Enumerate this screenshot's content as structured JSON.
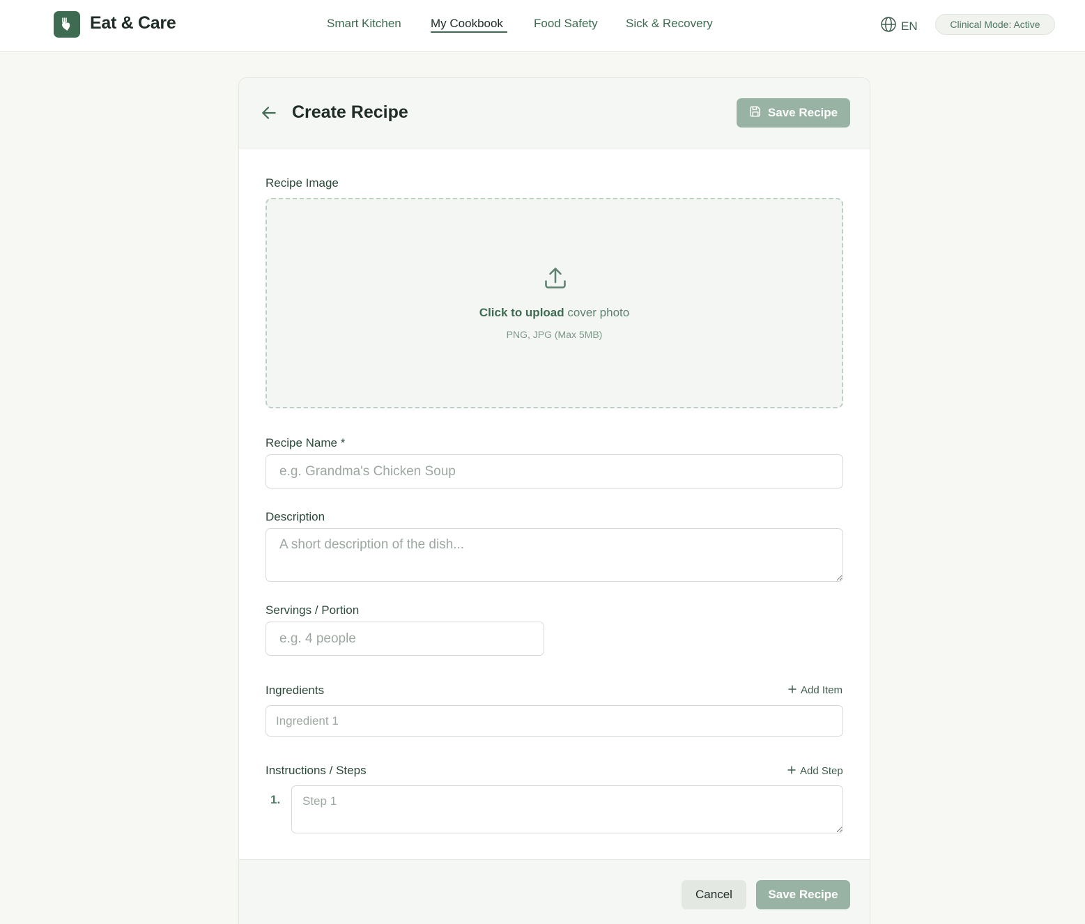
{
  "app": {
    "brand": "Eat & Care",
    "logo_icon": "heart-hand-utensils-icon",
    "accent_color": "#3f6b52"
  },
  "nav": {
    "items": [
      {
        "label": "Smart Kitchen",
        "active": false
      },
      {
        "label": "My Cookbook",
        "active": true
      },
      {
        "label": "Food Safety",
        "active": false
      },
      {
        "label": "Sick & Recovery",
        "active": false
      }
    ],
    "language": "EN",
    "mode_badge": "Clinical Mode: Active"
  },
  "page": {
    "title": "Create Recipe",
    "save_label": "Save Recipe"
  },
  "form": {
    "image": {
      "label": "Recipe Image",
      "upload_strong": "Click to upload",
      "upload_rest": " cover photo",
      "hint": "PNG, JPG (Max 5MB)"
    },
    "name": {
      "label": "Recipe Name *",
      "value": "",
      "placeholder": "e.g. Grandma's Chicken Soup"
    },
    "description": {
      "label": "Description",
      "value": "",
      "placeholder": "A short description of the dish..."
    },
    "servings": {
      "label": "Servings / Portion",
      "value": "",
      "placeholder": "e.g. 4 people"
    },
    "ingredients": {
      "label": "Ingredients",
      "add_label": "Add Item",
      "items": [
        {
          "value": "",
          "placeholder": "Ingredient 1"
        }
      ]
    },
    "steps": {
      "label": "Instructions / Steps",
      "add_label": "Add Step",
      "items": [
        {
          "number": "1.",
          "value": "",
          "placeholder": "Step 1"
        }
      ]
    }
  },
  "footer": {
    "cancel_label": "Cancel",
    "save_label": "Save Recipe"
  }
}
